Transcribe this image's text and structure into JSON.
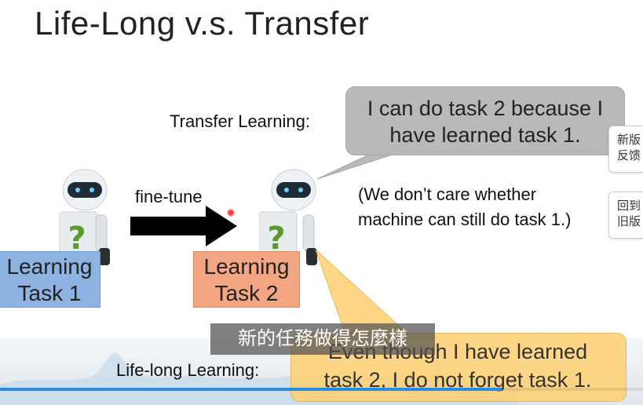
{
  "slide": {
    "title": "Life-Long v.s. Transfer",
    "transfer_label": "Transfer  Learning:",
    "bubble_top": [
      "I can do task 2 because I",
      "have learned task 1."
    ],
    "note": [
      "(We don’t care whether",
      "machine can still do task 1.)"
    ],
    "finetune_label": "fine-tune",
    "task1": [
      "Learning",
      "Task 1"
    ],
    "task2": [
      "Learning",
      "Task 2"
    ],
    "lifelong_label": "Life-long Learning:",
    "bubble_bottom": [
      "Even though I have learned",
      "task 2, I do not forget task 1."
    ]
  },
  "overlay": {
    "subtitle": "新的任務做得怎麼樣",
    "side_buttons": [
      {
        "label": [
          "新版",
          "反馈"
        ],
        "icon": "feedback"
      },
      {
        "label": [
          "回到",
          "旧版"
        ],
        "icon": "back"
      }
    ],
    "progress": 0.78
  },
  "colors": {
    "task1": "#8db3e2",
    "task2": "#f4a582",
    "bubble_top": "#b9b9b9",
    "bubble_bottom": "#ffd276",
    "progress": "#2a8ce0"
  }
}
